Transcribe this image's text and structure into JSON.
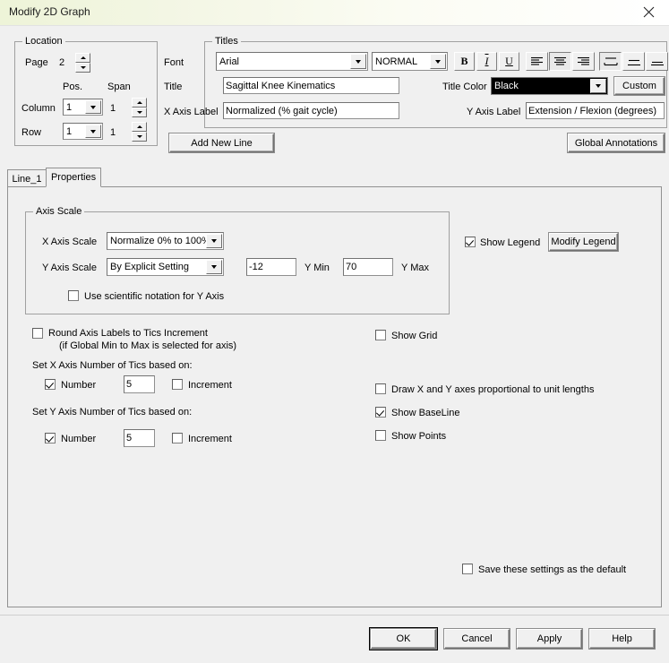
{
  "window": {
    "title": "Modify 2D Graph",
    "close_icon": "close-icon"
  },
  "location": {
    "legend": "Location",
    "page_label": "Page",
    "page_value": "2",
    "pos_header": "Pos.",
    "span_header": "Span",
    "column_label": "Column",
    "column_pos": "1",
    "column_span": "1",
    "row_label": "Row",
    "row_pos": "1",
    "row_span": "1"
  },
  "titles": {
    "legend": "Titles",
    "font_label": "Font",
    "font_value": "Arial",
    "font_style_value": "NORMAL",
    "bold_label": "B",
    "italic_label": "I",
    "underline_label": "U",
    "align_left": "align-left-icon",
    "align_center": "align-center-icon",
    "align_right": "align-right-icon",
    "valign_top": "valign-top-icon",
    "valign_middle": "valign-middle-icon",
    "valign_bottom": "valign-bottom-icon",
    "title_label": "Title",
    "title_value": "Sagittal Knee Kinematics",
    "title_color_label": "Title Color",
    "title_color_value": "Black",
    "title_color_hex": "#000000",
    "custom_button": "Custom",
    "x_axis_label_label": "X Axis Label",
    "x_axis_label_value": "Normalized (% gait cycle)",
    "y_axis_label_label": "Y Axis Label",
    "y_axis_label_value": "Extension / Flexion (degrees)"
  },
  "actions": {
    "add_new_line": "Add New Line",
    "global_annotations": "Global Annotations"
  },
  "tabs": [
    {
      "label": "Line_1",
      "active": false
    },
    {
      "label": "Properties",
      "active": true
    }
  ],
  "axis_scale": {
    "legend": "Axis Scale",
    "x_axis_scale_label": "X Axis Scale",
    "x_axis_scale_value": "Normalize 0% to 100%",
    "y_axis_scale_label": "Y Axis Scale",
    "y_axis_scale_value": "By Explicit Setting",
    "y_min_value": "-12",
    "y_min_label": "Y Min",
    "y_max_value": "70",
    "y_max_label": "Y Max",
    "scientific_notation_label": "Use scientific notation for Y Axis",
    "scientific_notation_checked": false
  },
  "legend_panel": {
    "show_legend_label": "Show Legend",
    "show_legend_checked": true,
    "modify_legend_button": "Modify Legend"
  },
  "tics": {
    "round_axis_labels_label": "Round Axis Labels to Tics Increment",
    "round_axis_labels_sub": "(if Global Min to Max is selected for axis)",
    "round_axis_labels_checked": false,
    "x_heading": "Set X Axis Number of Tics based on:",
    "x_number_label": "Number",
    "x_number_checked": true,
    "x_number_value": "5",
    "x_increment_label": "Increment",
    "x_increment_checked": false,
    "y_heading": "Set Y Axis Number of Tics based on:",
    "y_number_label": "Number",
    "y_number_checked": true,
    "y_number_value": "5",
    "y_increment_label": "Increment",
    "y_increment_checked": false
  },
  "display_options": {
    "show_grid_label": "Show Grid",
    "show_grid_checked": false,
    "proportional_axes_label": "Draw X and Y axes proportional to unit lengths",
    "proportional_axes_checked": false,
    "show_baseline_label": "Show BaseLine",
    "show_baseline_checked": true,
    "show_points_label": "Show Points",
    "show_points_checked": false,
    "save_default_label": "Save these settings as the default",
    "save_default_checked": false
  },
  "dialog_buttons": {
    "ok": "OK",
    "cancel": "Cancel",
    "apply": "Apply",
    "help": "Help"
  }
}
